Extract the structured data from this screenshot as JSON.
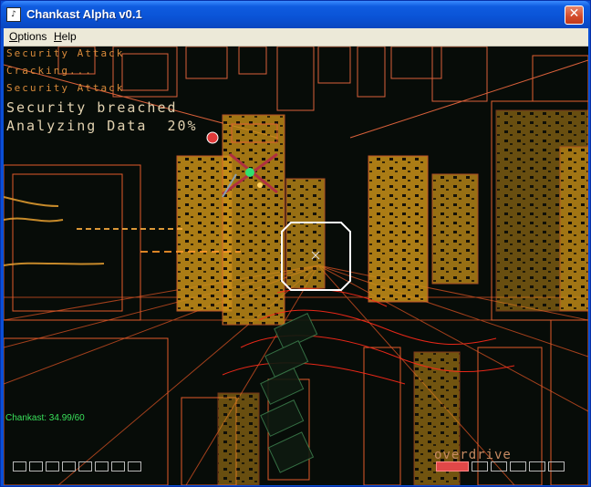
{
  "window": {
    "title": "Chankast Alpha v0.1",
    "icon_name": "app-icon",
    "close_symbol": "✕"
  },
  "menu": [
    {
      "label": "Options",
      "accel": "O",
      "rest": "ptions"
    },
    {
      "label": "Help",
      "accel": "H",
      "rest": "elp"
    }
  ],
  "hud": {
    "lines": [
      "Security Attack",
      "Cracking...",
      "Security Attack"
    ],
    "status_line_1": "Security breached",
    "status_line_2": "Analyzing Data  20%",
    "analyze_progress_percent": 20,
    "emulator_status": "Chankast: 34.99/60",
    "overdrive_label": "overdrive",
    "left_slots_total": 8,
    "right_slots_total": 7,
    "right_slots_filled": 1
  },
  "colors": {
    "wireframe": "#e05a2a",
    "block_fill": "#d8a020",
    "hud_text": "#d88a3a",
    "status_green": "#39e05a",
    "overdrive_fill": "#e04848"
  }
}
